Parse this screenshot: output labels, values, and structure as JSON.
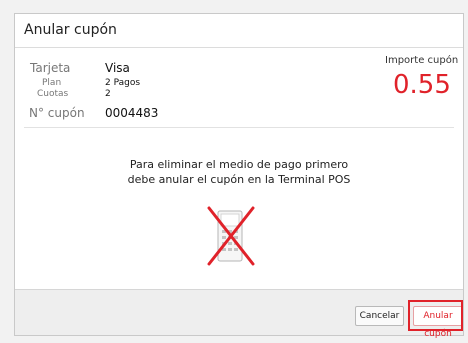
{
  "dialog": {
    "title": "Anular cupón"
  },
  "info": {
    "tarjeta_label": "Tarjeta",
    "tarjeta_value": "Visa",
    "plan_label": "Plan",
    "plan_value": "2 Pagos",
    "cuotas_label": "Cuotas",
    "cuotas_value": "2",
    "cupon_label": "N° cupón",
    "cupon_value": "0004483"
  },
  "importe": {
    "label": "Importe cupón",
    "value": "0.55",
    "color": "#e0222a"
  },
  "message": {
    "line1": "Para eliminar el medio de pago primero",
    "line2": "debe anular el cupón en la Terminal POS"
  },
  "illustration": {
    "icon": "pos-terminal-cancelled-icon"
  },
  "footer": {
    "cancel_label": "Cancelar",
    "anular_label": "Anular cupón"
  }
}
